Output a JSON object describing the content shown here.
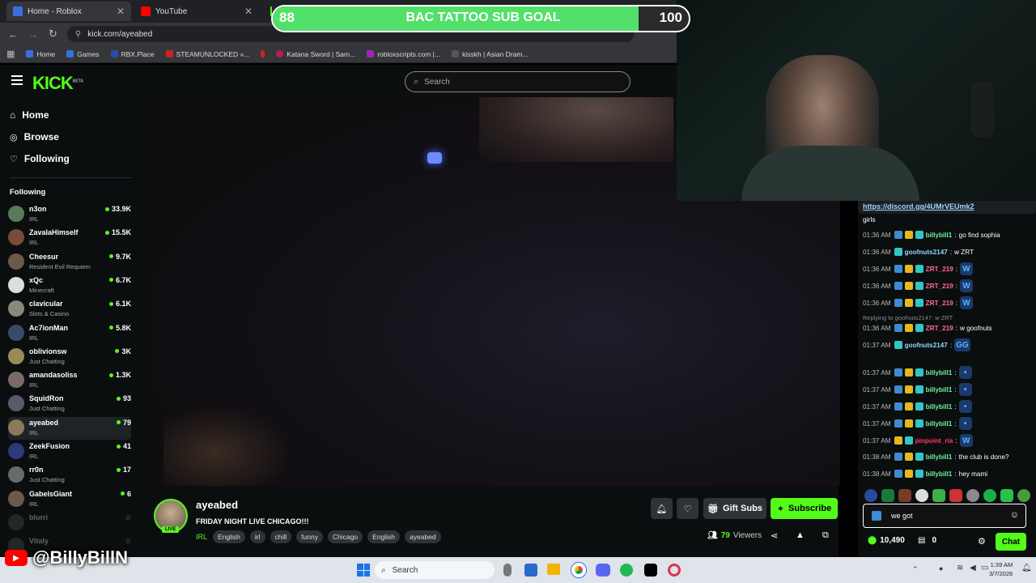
{
  "browser": {
    "tabs": [
      {
        "title": "Home - Roblox",
        "color": "#3a6fe0"
      },
      {
        "title": "YouTube",
        "color": "#ff0000"
      }
    ],
    "url": "kick.com/ayeabed",
    "bookmarks": [
      {
        "label": "Home",
        "color": "#3a6fe0"
      },
      {
        "label": "Games",
        "color": "#3a6fe0"
      },
      {
        "label": "RBX.Place",
        "color": "#2a4d9e"
      },
      {
        "label": "STEAMUNLOCKED »...",
        "color": "#c22"
      },
      {
        "label": "",
        "color": "#c22"
      },
      {
        "label": "Katana Sword | Sam...",
        "color": "#c2185b"
      },
      {
        "label": "robloxscripts.com |...",
        "color": "#9c27b0"
      },
      {
        "label": "kisskh | Asian Dram...",
        "color": "#222"
      }
    ]
  },
  "goal": {
    "current": "88",
    "title": "BAC TATTOO SUB GOAL",
    "target": "100",
    "progress": 0.88
  },
  "header": {
    "logo": "KICK",
    "beta": "BETA",
    "search_placeholder": "Search"
  },
  "sidebar": {
    "nav": [
      {
        "label": "Home",
        "icon": "home-icon"
      },
      {
        "label": "Browse",
        "icon": "compass-icon"
      },
      {
        "label": "Following",
        "icon": "heart-icon"
      }
    ],
    "following_title": "Following",
    "following": [
      {
        "name": "n3on",
        "category": "IRL",
        "viewers": "33.9K",
        "color": "#5a7a5a"
      },
      {
        "name": "ZavalaHimself",
        "category": "IRL",
        "viewers": "15.5K",
        "color": "#7a4a3a"
      },
      {
        "name": "Cheesur",
        "category": "Resident Evil Requiem",
        "viewers": "9.7K",
        "color": "#6a5a4a"
      },
      {
        "name": "xQc",
        "category": "Minecraft",
        "viewers": "6.7K",
        "color": "#ddd"
      },
      {
        "name": "clavicular",
        "category": "Slots & Casino",
        "viewers": "6.1K",
        "color": "#8a8a7a"
      },
      {
        "name": "Ac7ionMan",
        "category": "IRL",
        "viewers": "5.8K",
        "color": "#3a4a6a"
      },
      {
        "name": "oblivionsw",
        "category": "Just Chatting",
        "viewers": "3K",
        "color": "#9a8a5a"
      },
      {
        "name": "amandasoliss",
        "category": "IRL",
        "viewers": "1.3K",
        "color": "#7a6a6a"
      },
      {
        "name": "SquidRon",
        "category": "Just Chatting",
        "viewers": "93",
        "color": "#5a5a6a"
      },
      {
        "name": "ayeabed",
        "category": "IRL",
        "viewers": "79",
        "color": "#8a7a5a"
      },
      {
        "name": "ZeekFusion",
        "category": "IRL",
        "viewers": "41",
        "color": "#2a3a7a"
      },
      {
        "name": "rr0n",
        "category": "Just Chatting",
        "viewers": "17",
        "color": "#6a6a6a"
      },
      {
        "name": "GabelsGiant",
        "category": "IRL",
        "viewers": "6",
        "color": "#6a5a4a"
      },
      {
        "name": "blurri",
        "category": "",
        "viewers": "",
        "color": "#555"
      },
      {
        "name": "Vitaly",
        "category": "",
        "viewers": "",
        "color": "#555"
      }
    ]
  },
  "overlay": {
    "handle": "@BillyBillN"
  },
  "stream": {
    "streamer": "ayeabed",
    "live_badge": "LIVE",
    "title": "FRIDAY NIGHT LIVE CHICAGO!!!",
    "category": "IRL",
    "tags": [
      "English",
      "irl",
      "chill",
      "funny",
      "Chicago",
      "English",
      "ayeabed"
    ],
    "viewers": "79",
    "viewers_label": "Viewers",
    "gift_subs": "Gift Subs",
    "subscribe": "Subscribe"
  },
  "chat": {
    "pinned_link": "https://discord.gg/4UMrVEUmk2",
    "first_line": "girls",
    "reply_note": "Replying to goofnuts2147: w ZRT",
    "messages": [
      {
        "time": "01:36 AM",
        "user": "billybill1",
        "color": "#6cf0a0",
        "badges": 3,
        "text": "go find sophia",
        "emote": ""
      },
      {
        "time": "01:36 AM",
        "user": "goofnuts2147",
        "color": "#8fd8ff",
        "badges": 1,
        "text": "w ZRT",
        "emote": ""
      },
      {
        "time": "01:36 AM",
        "user": "ZRT_219",
        "color": "#ff6b9a",
        "badges": 3,
        "text": "",
        "emote": "W"
      },
      {
        "time": "01:36 AM",
        "user": "ZRT_219",
        "color": "#ff6b9a",
        "badges": 3,
        "text": "",
        "emote": "W"
      },
      {
        "time": "01:36 AM",
        "user": "ZRT_219",
        "color": "#ff6b9a",
        "badges": 3,
        "text": "",
        "emote": "W"
      },
      {
        "time": "01:36 AM",
        "user": "ZRT_219",
        "color": "#ff6b9a",
        "badges": 3,
        "text": "w goofnuts",
        "emote": ""
      },
      {
        "time": "01:37 AM",
        "user": "goofnuts2147",
        "color": "#8fd8ff",
        "badges": 1,
        "text": "",
        "emote": "GG"
      },
      {
        "time": "01:37 AM",
        "user": "billybill1",
        "color": "#6cf0a0",
        "badges": 3,
        "text": "",
        "emote": "•"
      },
      {
        "time": "01:37 AM",
        "user": "billybill1",
        "color": "#6cf0a0",
        "badges": 3,
        "text": "",
        "emote": "•"
      },
      {
        "time": "01:37 AM",
        "user": "billybill1",
        "color": "#6cf0a0",
        "badges": 3,
        "text": "",
        "emote": "•"
      },
      {
        "time": "01:37 AM",
        "user": "billybill1",
        "color": "#6cf0a0",
        "badges": 3,
        "text": "",
        "emote": "•"
      },
      {
        "time": "01:37 AM",
        "user": "pinpoint_ria",
        "color": "#ff3b5c",
        "badges": 2,
        "text": "",
        "emote": "W"
      },
      {
        "time": "01:38 AM",
        "user": "billybill1",
        "color": "#6cf0a0",
        "badges": 3,
        "text": "the club is done?",
        "emote": ""
      },
      {
        "time": "01:38 AM",
        "user": "billybill1",
        "color": "#6cf0a0",
        "badges": 3,
        "text": "hey mami",
        "emote": ""
      }
    ],
    "input_value": "we got",
    "points": "10,490",
    "gift_count": "0",
    "send_label": "Chat"
  },
  "taskbar": {
    "search_placeholder": "Search",
    "time": "1:39 AM",
    "date": "3/7/2026"
  }
}
